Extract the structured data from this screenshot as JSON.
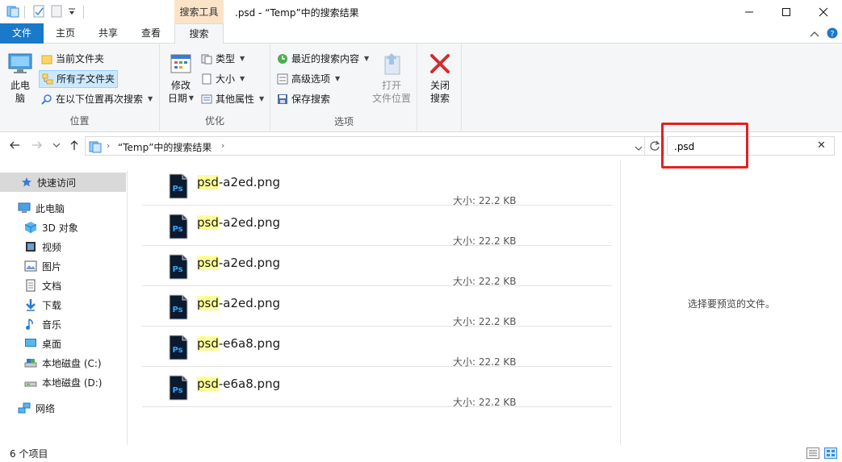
{
  "titlebar": {
    "context_tab": "搜索工具",
    "title": ".psd - “Temp”中的搜索结果"
  },
  "ribbon_tabs": [
    "文件",
    "主页",
    "共享",
    "查看",
    "搜索"
  ],
  "ribbon": {
    "location": {
      "label": "位置",
      "this_pc_line1": "此电",
      "this_pc_line2": "脑",
      "current_folder": "当前文件夹",
      "all_subfolders": "所有子文件夹",
      "search_again": "在以下位置再次搜索"
    },
    "refine": {
      "label": "优化",
      "date_modified_line1": "修改",
      "date_modified_line2": "日期",
      "kind": "类型",
      "size": "大小",
      "other_properties": "其他属性"
    },
    "options": {
      "label": "选项",
      "recent_searches": "最近的搜索内容",
      "advanced_options": "高级选项",
      "save_search": "保存搜索",
      "open_location_line1": "打开",
      "open_location_line2": "文件位置",
      "close_line1": "关闭",
      "close_line2": "搜索"
    }
  },
  "address": {
    "path": "“Temp”中的搜索结果",
    "search_value": ".psd"
  },
  "nav": {
    "quick_access": "快速访问",
    "this_pc": "此电脑",
    "objects_3d": "3D 对象",
    "videos": "视频",
    "pictures": "图片",
    "documents": "文档",
    "downloads": "下载",
    "music": "音乐",
    "desktop": "桌面",
    "disk_c": "本地磁盘 (C:)",
    "disk_d": "本地磁盘 (D:)",
    "network": "网络"
  },
  "files": [
    {
      "match": "psd",
      "rest": "-a2ed.png",
      "size": "大小: 22.2 KB"
    },
    {
      "match": "psd",
      "rest": "-a2ed.png",
      "size": "大小: 22.2 KB"
    },
    {
      "match": "psd",
      "rest": "-a2ed.png",
      "size": "大小: 22.2 KB"
    },
    {
      "match": "psd",
      "rest": "-a2ed.png",
      "size": "大小: 22.2 KB"
    },
    {
      "match": "psd",
      "rest": "-e6a8.png",
      "size": "大小: 22.2 KB"
    },
    {
      "match": "psd",
      "rest": "-e6a8.png",
      "size": "大小: 22.2 KB"
    }
  ],
  "preview": {
    "empty_text": "选择要预览的文件。"
  },
  "status": {
    "item_count": "6 个项目"
  },
  "colors": {
    "accent": "#1979ca",
    "highlight": "#ffff99",
    "annotation_box": "#e02222",
    "ps_icon_bg": "#0b1a2e",
    "ps_icon_text": "#31a8ff"
  }
}
